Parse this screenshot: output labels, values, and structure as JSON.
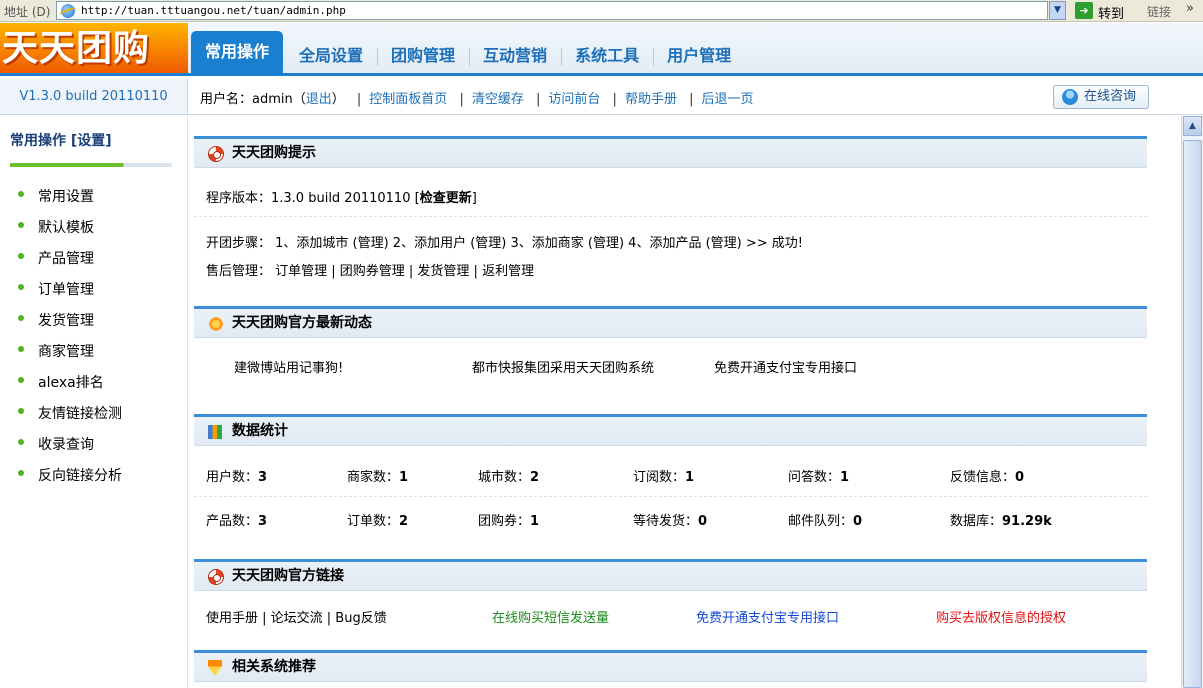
{
  "browser": {
    "address_label": "地址 (D)",
    "url": "http://tuan.tttuangou.net/tuan/admin.php",
    "go_label": "转到",
    "links_label": "链接",
    "more": "»"
  },
  "header": {
    "logo_text": "天天团购",
    "tabs": [
      "常用操作",
      "全局设置",
      "团购管理",
      "互动营销",
      "系统工具",
      "用户管理"
    ],
    "active_tab": 0
  },
  "subbar": {
    "version": "V1.3.0 build 20110110",
    "username_prefix": "用户名：admin（",
    "logout": "退出",
    "username_suffix": "）",
    "links": [
      "控制面板首页",
      "清空缓存",
      "访问前台",
      "帮助手册",
      "后退一页"
    ],
    "consult_label": "在线咨询"
  },
  "sidebar": {
    "title": "常用操作 [设置]",
    "items": [
      "常用设置",
      "默认模板",
      "产品管理",
      "订单管理",
      "发货管理",
      "商家管理",
      "alexa排名",
      "友情链接检测",
      "收录查询",
      "反向链接分析"
    ]
  },
  "panels": {
    "tips": {
      "title": "天天团购提示",
      "version_prefix": "程序版本：1.3.0 build 20110110 [",
      "check_update": "检查更新",
      "version_suffix": "]",
      "steps": "开团步骤： 1、添加城市 (管理)  2、添加用户 (管理)  3、添加商家 (管理)  4、添加产品 (管理) >> 成功!",
      "after_sales": "售后管理： 订单管理 |  团购券管理 |  发货管理 |  返利管理"
    },
    "news": {
      "title": "天天团购官方最新动态",
      "items": [
        "建微博站用记事狗!",
        "都市快报集团采用天天团购系统",
        "免费开通支付宝专用接口"
      ]
    },
    "stats": {
      "title": "数据统计",
      "row1": [
        {
          "label": "用户数：",
          "value": "3"
        },
        {
          "label": "商家数：",
          "value": "1"
        },
        {
          "label": "城市数：",
          "value": "2"
        },
        {
          "label": "订阅数：",
          "value": "1"
        },
        {
          "label": "问答数：",
          "value": "1"
        },
        {
          "label": "反馈信息：",
          "value": "0"
        }
      ],
      "row2": [
        {
          "label": "产品数：",
          "value": "3"
        },
        {
          "label": "订单数：",
          "value": "2"
        },
        {
          "label": "团购券：",
          "value": "1"
        },
        {
          "label": "等待发货：",
          "value": "0"
        },
        {
          "label": "邮件队列：",
          "value": "0"
        },
        {
          "label": "数据库：",
          "value": "91.29k"
        }
      ]
    },
    "links": {
      "title": "天天团购官方链接",
      "plain": "使用手册 | 论坛交流 | Bug反馈",
      "green": "在线购买短信发送量",
      "blue": "免费开通支付宝专用接口",
      "red": "购买去版权信息的授权"
    },
    "related": {
      "title": "相关系统推荐"
    }
  },
  "colors": {
    "accent": "#1a7fce",
    "link": "#1c6fb8",
    "green_dot": "#4fb324"
  }
}
